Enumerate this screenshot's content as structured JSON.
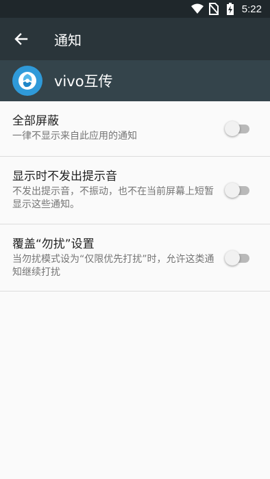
{
  "status_bar": {
    "time": "5:22",
    "icons": [
      "wifi-icon",
      "no-sim-icon",
      "battery-charging-icon"
    ]
  },
  "toolbar": {
    "back_icon": "arrow-back-icon",
    "title": "通知"
  },
  "app": {
    "icon": "vivo-share-app-icon",
    "name": "vivo互传"
  },
  "settings": [
    {
      "title": "全部屏蔽",
      "summary": "一律不显示来自此应用的通知",
      "enabled": false
    },
    {
      "title": "显示时不发出提示音",
      "summary": "不发出提示音，不振动，也不在当前屏幕上短暂显示这些通知。",
      "enabled": false
    },
    {
      "title": "覆盖“勿扰”设置",
      "summary": "当勿扰模式设为“仅限优先打扰”时，允许这类通知继续打扰",
      "enabled": false
    }
  ],
  "colors": {
    "status_bar": "#1f272b",
    "toolbar": "#2a353a",
    "app_header": "#34444b",
    "app_icon": "#2f9ad9",
    "background": "#fafafa"
  }
}
